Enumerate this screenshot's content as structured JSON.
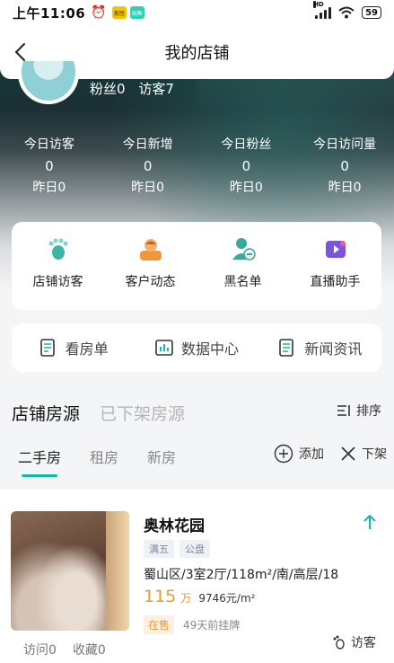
{
  "status_bar": {
    "time": "上午11:06",
    "app1": "美团",
    "app2": "闲鱼",
    "network": "HD",
    "battery": "59"
  },
  "nav": {
    "title": "我的店铺"
  },
  "profile": {
    "fans": "粉丝0",
    "visitors": "访客7"
  },
  "stats": [
    {
      "label": "今日访客",
      "value": "0",
      "yesterday": "昨日0"
    },
    {
      "label": "今日新增",
      "value": "0",
      "yesterday": "昨日0"
    },
    {
      "label": "今日粉丝",
      "value": "0",
      "yesterday": "昨日0"
    },
    {
      "label": "今日访问量",
      "value": "0",
      "yesterday": "昨日0"
    }
  ],
  "tools": [
    {
      "label": "店铺访客",
      "icon": "footprint-icon",
      "color": "#3bb6a8"
    },
    {
      "label": "客户动态",
      "icon": "customer-icon",
      "color": "#f0973a"
    },
    {
      "label": "黑名单",
      "icon": "blacklist-icon",
      "color": "#3aa89a"
    },
    {
      "label": "直播助手",
      "icon": "live-icon",
      "color": "#7b55d8"
    }
  ],
  "links": [
    {
      "label": "看房单",
      "icon": "list-icon"
    },
    {
      "label": "数据中心",
      "icon": "chart-icon"
    },
    {
      "label": "新闻资讯",
      "icon": "news-icon"
    }
  ],
  "section": {
    "tabs": [
      "店铺房源",
      "已下架房源"
    ],
    "sort": "排序",
    "sub_tabs": [
      "二手房",
      "租房",
      "新房"
    ],
    "add": "添加",
    "remove": "下架"
  },
  "listing": {
    "title": "奥林花园",
    "tags": [
      "满五",
      "公盘"
    ],
    "desc": "蜀山区/3室2厅/118m²/南/高层/18",
    "price": "115",
    "price_unit": "万",
    "unit_price": "9746元/m²",
    "status": "在售",
    "posted": "49天前挂牌",
    "visits": "访问0",
    "favorites": "收藏0",
    "visitor_label": "访客"
  },
  "colors": {
    "accent": "#14b8a6",
    "price": "#e29b3c"
  }
}
